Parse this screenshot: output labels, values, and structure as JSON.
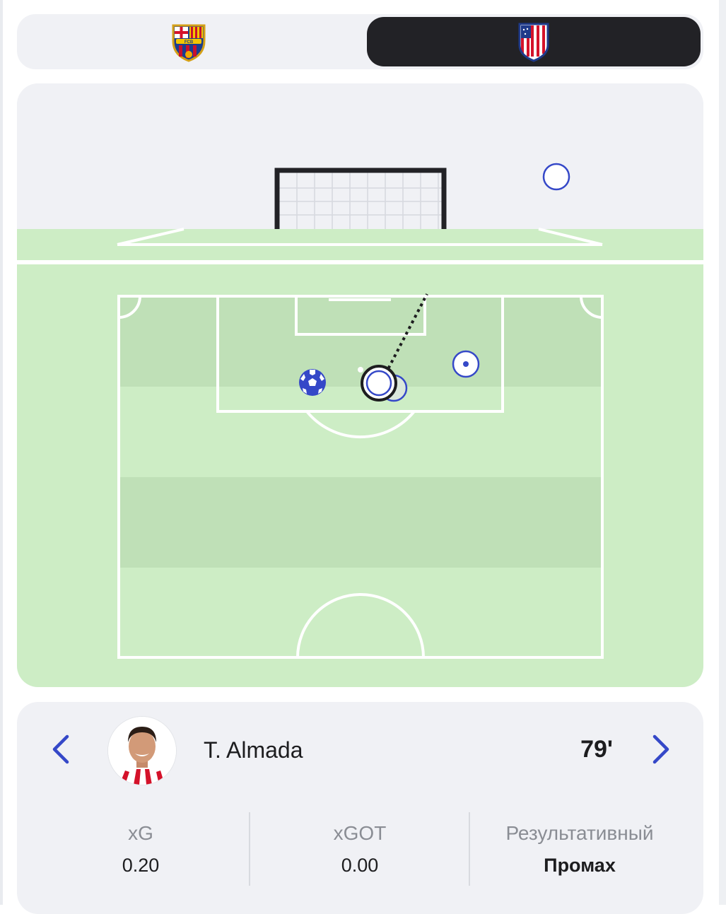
{
  "teams": {
    "home": {
      "crest_icon": "fc-barcelona-crest-icon",
      "selected": false
    },
    "away": {
      "crest_icon": "atletico-madrid-crest-icon",
      "selected": true
    }
  },
  "shot": {
    "player_name": "T. Almada",
    "minute": "79'",
    "stats": [
      {
        "label": "xG",
        "value": "0.20"
      },
      {
        "label": "xGOT",
        "value": "0.00"
      },
      {
        "label": "Результативный",
        "value": "Промах"
      }
    ]
  },
  "nav": {
    "prev_icon": "chevron-left-icon",
    "next_icon": "chevron-right-icon"
  },
  "colors": {
    "accent": "#3548c8",
    "pitch_light": "#cdedc5",
    "pitch_dark": "#bfe0b7",
    "card_bg": "#f0f1f5",
    "selected_tab": "#222226"
  }
}
